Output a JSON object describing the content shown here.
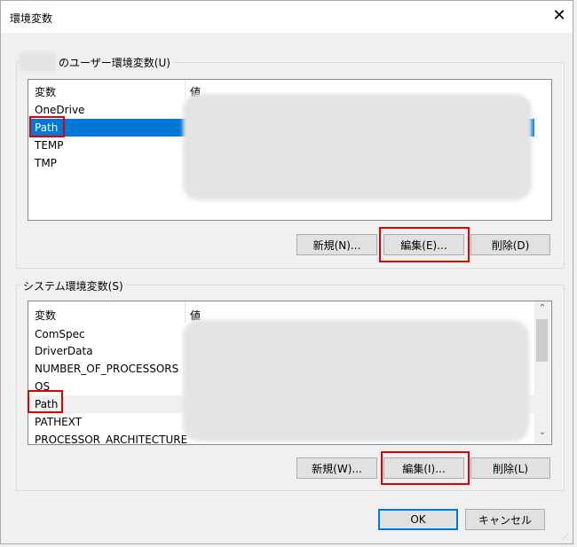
{
  "window": {
    "title": "環境変数",
    "close_icon": "close-icon"
  },
  "user_vars": {
    "label": "のユーザー環境変数(U)",
    "columns": [
      "変数",
      "値"
    ],
    "rows": [
      "OneDrive",
      "Path",
      "TEMP",
      "TMP"
    ],
    "selected": "Path",
    "buttons": {
      "new": "新規(N)...",
      "edit": "編集(E)...",
      "delete": "削除(D)"
    }
  },
  "system_vars": {
    "label": "システム環境変数(S)",
    "columns": [
      "変数",
      "値"
    ],
    "rows": [
      "ComSpec",
      "DriverData",
      "NUMBER_OF_PROCESSORS",
      "OS",
      "Path",
      "PATHEXT",
      "PROCESSOR_ARCHITECTURE"
    ],
    "hovered": "Path",
    "buttons": {
      "new": "新規(W)...",
      "edit": "編集(I)...",
      "delete": "削除(L)"
    }
  },
  "footer": {
    "ok": "OK",
    "cancel": "キャンセル"
  },
  "colors": {
    "selection": "#0078d7",
    "highlight": "#e00000"
  }
}
